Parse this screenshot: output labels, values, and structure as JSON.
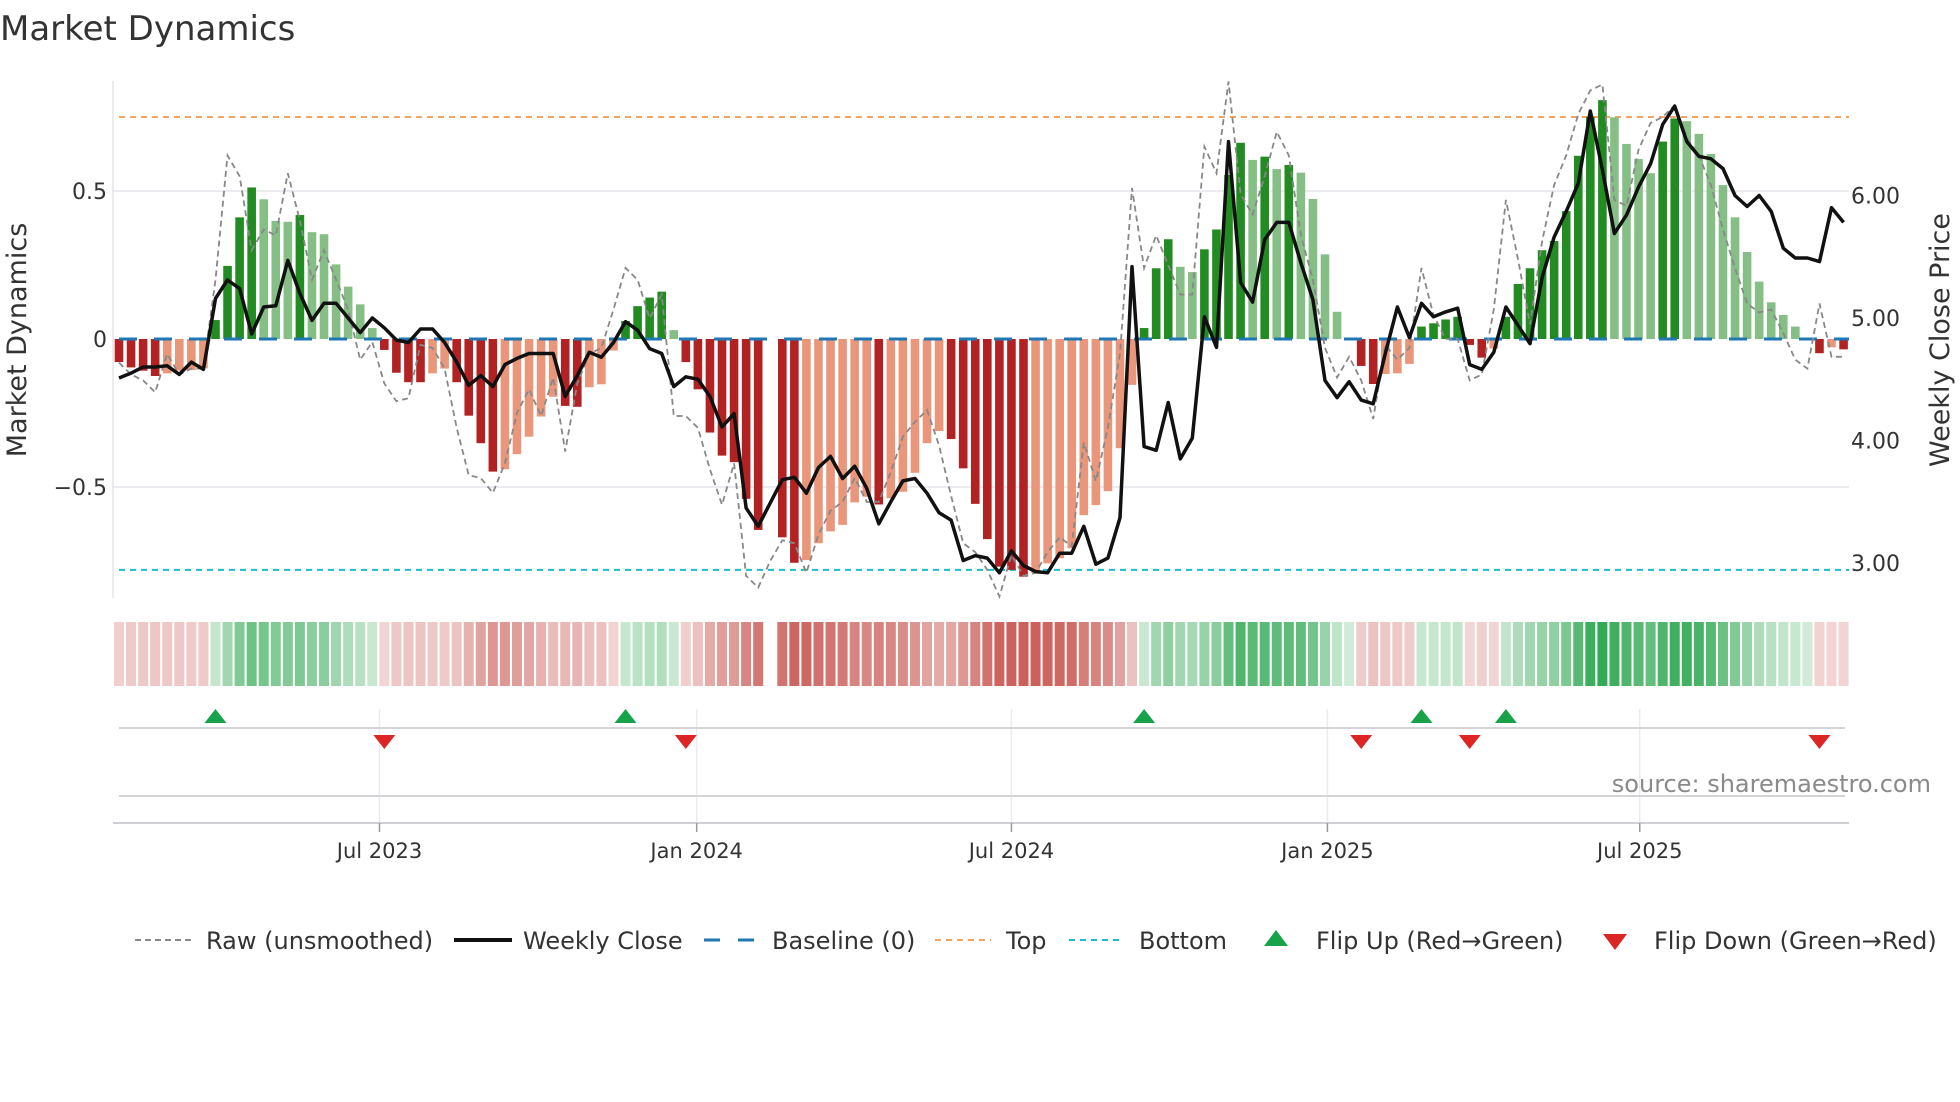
{
  "title": "Market Dynamics",
  "source": "source: sharemaestro.com",
  "colors": {
    "dark_red": "#b22222",
    "light_red": "#e9967a",
    "dark_green": "#228b22",
    "light_green": "#85bf85",
    "baseline": "#1f77b4",
    "top": "#f4a460",
    "bottom": "#17becf",
    "raw": "#888888",
    "close": "#111111",
    "flip_up": "#17a34a",
    "flip_down": "#dc2626",
    "strip_red": "200,85,80",
    "strip_green": "40,165,75"
  },
  "chart_data": {
    "type": "bar",
    "title": "Market Dynamics",
    "ylabel": "Market Dynamics",
    "y2label": "Weekly Close Price",
    "ylim": [
      -0.88,
      0.93
    ],
    "y2lim": [
      2.4,
      6.95
    ],
    "yticks": [
      {
        "v": 0.5,
        "label": "0.5"
      },
      {
        "v": 0,
        "label": "0"
      },
      {
        "v": -0.5,
        "label": "−0.5"
      }
    ],
    "y2ticks": [
      {
        "v": 6,
        "label": "6.00"
      },
      {
        "v": 5,
        "label": "5.00"
      },
      {
        "v": 4,
        "label": "4.00"
      },
      {
        "v": 3,
        "label": "3.00"
      }
    ],
    "xticks": [
      {
        "week": 21.6,
        "label": "Jul 2023"
      },
      {
        "week": 47.9,
        "label": "Jan 2024"
      },
      {
        "week": 74.0,
        "label": "Jul 2024"
      },
      {
        "week": 100.2,
        "label": "Jan 2025"
      },
      {
        "week": 126.1,
        "label": "Jul 2025"
      }
    ],
    "top": 0.75,
    "bottom": -0.78,
    "baseline": 0,
    "momentum": [
      -0.078,
      -0.096,
      -0.107,
      -0.125,
      -0.116,
      -0.107,
      -0.105,
      -0.099,
      0.064,
      0.247,
      0.411,
      0.512,
      0.472,
      0.399,
      0.396,
      0.419,
      0.361,
      0.354,
      0.252,
      0.177,
      0.117,
      0.037,
      -0.037,
      -0.114,
      -0.146,
      -0.146,
      -0.116,
      -0.1,
      -0.146,
      -0.259,
      -0.352,
      -0.448,
      -0.44,
      -0.389,
      -0.33,
      -0.262,
      -0.195,
      -0.226,
      -0.229,
      -0.163,
      -0.153,
      -0.039,
      0.061,
      0.111,
      0.14,
      0.16,
      0.03,
      -0.078,
      -0.17,
      -0.316,
      -0.394,
      -0.416,
      -0.54,
      -0.645,
      null,
      -0.67,
      -0.756,
      -0.747,
      -0.69,
      -0.65,
      -0.628,
      -0.552,
      -0.533,
      -0.559,
      -0.538,
      -0.516,
      -0.452,
      -0.352,
      -0.311,
      -0.338,
      -0.437,
      -0.557,
      -0.676,
      -0.769,
      -0.78,
      -0.803,
      -0.79,
      -0.758,
      -0.741,
      -0.707,
      -0.595,
      -0.561,
      -0.514,
      -0.369,
      -0.155,
      0.037,
      0.239,
      0.337,
      0.244,
      0.226,
      0.303,
      0.37,
      0.554,
      0.663,
      0.605,
      0.616,
      0.574,
      0.588,
      0.562,
      0.473,
      0.286,
      0.092,
      0.004,
      -0.091,
      -0.152,
      -0.118,
      -0.116,
      -0.084,
      0.042,
      0.053,
      0.066,
      0.075,
      -0.02,
      -0.063,
      -0.032,
      0.075,
      0.186,
      0.239,
      0.3,
      0.331,
      0.432,
      0.619,
      0.75,
      0.807,
      0.749,
      0.659,
      0.608,
      0.56,
      0.667,
      0.745,
      0.736,
      0.693,
      0.625,
      0.52,
      0.411,
      0.294,
      0.194,
      0.124,
      0.081,
      0.042,
      0.004,
      -0.048,
      -0.028,
      -0.035
    ],
    "shade_runs": [
      [
        4,
        "D"
      ],
      [
        4,
        "L"
      ],
      [
        4,
        "D"
      ],
      [
        3,
        "L"
      ],
      [
        1,
        "D"
      ],
      [
        6,
        "L"
      ],
      [
        4,
        "D"
      ],
      [
        2,
        "L"
      ],
      [
        4,
        "D"
      ],
      [
        5,
        "L"
      ],
      [
        2,
        "D"
      ],
      [
        3,
        "L"
      ],
      [
        4,
        "D"
      ],
      [
        1,
        "L"
      ],
      [
        7,
        "D"
      ],
      [
        1,
        "-"
      ],
      [
        2,
        "D"
      ],
      [
        6,
        "L"
      ],
      [
        1,
        "D"
      ],
      [
        5,
        "L"
      ],
      [
        7,
        "D"
      ],
      [
        9,
        "L"
      ],
      [
        3,
        "D"
      ],
      [
        2,
        "L"
      ],
      [
        4,
        "D"
      ],
      [
        1,
        "L"
      ],
      [
        1,
        "D"
      ],
      [
        1,
        "L"
      ],
      [
        1,
        "D"
      ],
      [
        5,
        "L"
      ],
      [
        2,
        "D"
      ],
      [
        3,
        "L"
      ],
      [
        6,
        "D"
      ],
      [
        1,
        "L"
      ],
      [
        9,
        "D"
      ],
      [
        4,
        "L"
      ],
      [
        2,
        "D"
      ],
      [
        11,
        "L"
      ],
      [
        1,
        "D"
      ],
      [
        1,
        "L"
      ],
      [
        1,
        "D"
      ]
    ],
    "raw": [
      -0.08,
      -0.12,
      -0.14,
      -0.18,
      -0.05,
      -0.12,
      -0.1,
      -0.1,
      0.2,
      0.62,
      0.55,
      0.3,
      0.37,
      0.35,
      0.56,
      0.4,
      0.2,
      0.3,
      0.2,
      0.1,
      -0.07,
      -0.01,
      -0.15,
      -0.21,
      -0.2,
      -0.02,
      -0.03,
      -0.1,
      -0.3,
      -0.46,
      -0.47,
      -0.52,
      -0.42,
      -0.25,
      -0.17,
      -0.26,
      -0.13,
      -0.38,
      -0.15,
      -0.05,
      -0.03,
      0.1,
      0.24,
      0.2,
      0.07,
      0.15,
      -0.26,
      -0.26,
      -0.3,
      -0.44,
      -0.56,
      -0.42,
      -0.8,
      -0.84,
      -0.75,
      -0.68,
      -0.69,
      -0.79,
      -0.66,
      -0.58,
      -0.55,
      -0.47,
      -0.55,
      -0.55,
      -0.45,
      -0.33,
      -0.28,
      -0.24,
      -0.36,
      -0.53,
      -0.69,
      -0.72,
      -0.78,
      -0.87,
      -0.73,
      -0.8,
      -0.79,
      -0.72,
      -0.67,
      -0.7,
      -0.35,
      -0.48,
      -0.3,
      -0.05,
      0.51,
      0.24,
      0.35,
      0.25,
      0.15,
      0.15,
      0.65,
      0.56,
      0.87,
      0.49,
      0.42,
      0.55,
      0.7,
      0.62,
      0.35,
      0.2,
      -0.03,
      -0.13,
      -0.06,
      -0.14,
      -0.27,
      -0.02,
      -0.07,
      -0.03,
      0.24,
      0.08,
      0.0,
      0.0,
      -0.14,
      -0.12,
      0.1,
      0.47,
      0.27,
      0.05,
      0.33,
      0.52,
      0.62,
      0.76,
      0.84,
      0.86,
      0.47,
      0.45,
      0.64,
      0.73,
      0.75,
      0.79,
      0.68,
      0.62,
      0.52,
      0.37,
      0.24,
      0.12,
      0.09,
      0.1,
      0.02,
      -0.07,
      -0.1,
      0.12,
      -0.06,
      -0.06
    ],
    "close": [
      4.51,
      4.55,
      4.6,
      4.6,
      4.61,
      4.54,
      4.64,
      4.58,
      5.16,
      5.31,
      5.24,
      4.87,
      5.09,
      5.1,
      5.47,
      5.2,
      4.98,
      5.12,
      5.12,
      5.0,
      4.88,
      5.0,
      4.92,
      4.82,
      4.8,
      4.91,
      4.91,
      4.8,
      4.64,
      4.45,
      4.53,
      4.44,
      4.62,
      4.67,
      4.71,
      4.71,
      4.71,
      4.36,
      4.53,
      4.72,
      4.68,
      4.8,
      4.97,
      4.9,
      4.75,
      4.71,
      4.44,
      4.52,
      4.5,
      4.36,
      4.11,
      4.22,
      3.45,
      3.3,
      3.49,
      3.68,
      3.7,
      3.57,
      3.78,
      3.87,
      3.69,
      3.79,
      3.61,
      3.32,
      3.5,
      3.67,
      3.69,
      3.57,
      3.41,
      3.35,
      3.02,
      3.06,
      3.04,
      2.92,
      3.1,
      2.98,
      2.93,
      2.92,
      3.08,
      3.08,
      3.3,
      2.99,
      3.04,
      3.37,
      5.42,
      3.95,
      3.92,
      4.31,
      3.85,
      4.02,
      5.01,
      4.76,
      6.44,
      5.29,
      5.13,
      5.64,
      5.78,
      5.78,
      5.45,
      5.15,
      4.49,
      4.35,
      4.48,
      4.33,
      4.3,
      4.71,
      5.09,
      4.84,
      5.12,
      5.01,
      5.05,
      5.08,
      4.62,
      4.58,
      4.72,
      5.09,
      4.94,
      4.79,
      5.33,
      5.66,
      5.87,
      6.1,
      6.69,
      6.21,
      5.69,
      5.84,
      6.07,
      6.26,
      6.58,
      6.73,
      6.44,
      6.32,
      6.3,
      6.22,
      6.0,
      5.91,
      6.0,
      5.87,
      5.57,
      5.49,
      5.49,
      5.46,
      5.9,
      5.78
    ],
    "flip_up": [
      8,
      42,
      85,
      108,
      115
    ],
    "flip_down": [
      22,
      47,
      103,
      112,
      141
    ],
    "legend": {
      "position": "bottom",
      "items": [
        {
          "key": "raw",
          "label": "Raw (unsmoothed)"
        },
        {
          "key": "close",
          "label": "Weekly Close"
        },
        {
          "key": "baseline",
          "label": "Baseline (0)"
        },
        {
          "key": "top",
          "label": "Top"
        },
        {
          "key": "bottom",
          "label": "Bottom"
        },
        {
          "key": "flip_up",
          "label": "Flip Up (Red→Green)"
        },
        {
          "key": "flip_down",
          "label": "Flip Down (Green→Red)"
        }
      ]
    }
  }
}
